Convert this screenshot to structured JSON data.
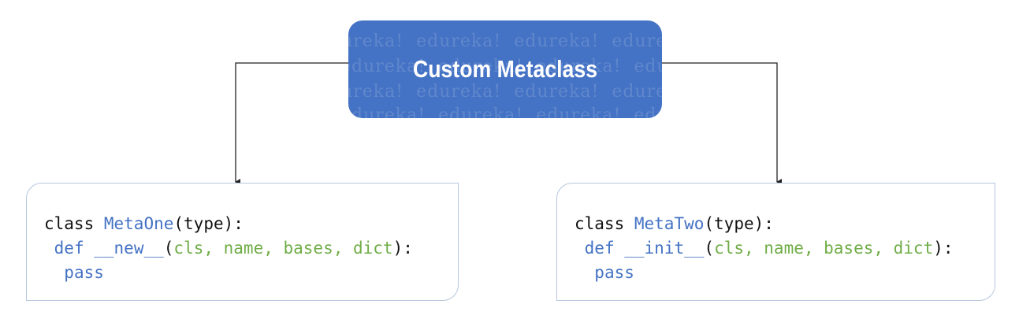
{
  "header": {
    "title": "Custom Metaclass",
    "watermark_text": "edureka!",
    "fill_color": "#4472c4"
  },
  "colors": {
    "keyword": "#111111",
    "name": "#4472c4",
    "params": "#70ad47",
    "connector": "#222222"
  },
  "left_box": {
    "line1": {
      "kw": "class",
      "name": "MetaOne",
      "rest": "(type):"
    },
    "line2": {
      "kw": "def",
      "method": "__new__",
      "open": "(",
      "params": "cls, name, bases, dict",
      "close": "):"
    },
    "line3": {
      "kw": "pass"
    }
  },
  "right_box": {
    "line1": {
      "kw": "class",
      "name": "MetaTwo",
      "rest": "(type):"
    },
    "line2": {
      "kw": "def",
      "method": "__init__",
      "open": "(",
      "params": "cls, name, bases, dict",
      "close": "):"
    },
    "line3": {
      "kw": "pass"
    }
  }
}
